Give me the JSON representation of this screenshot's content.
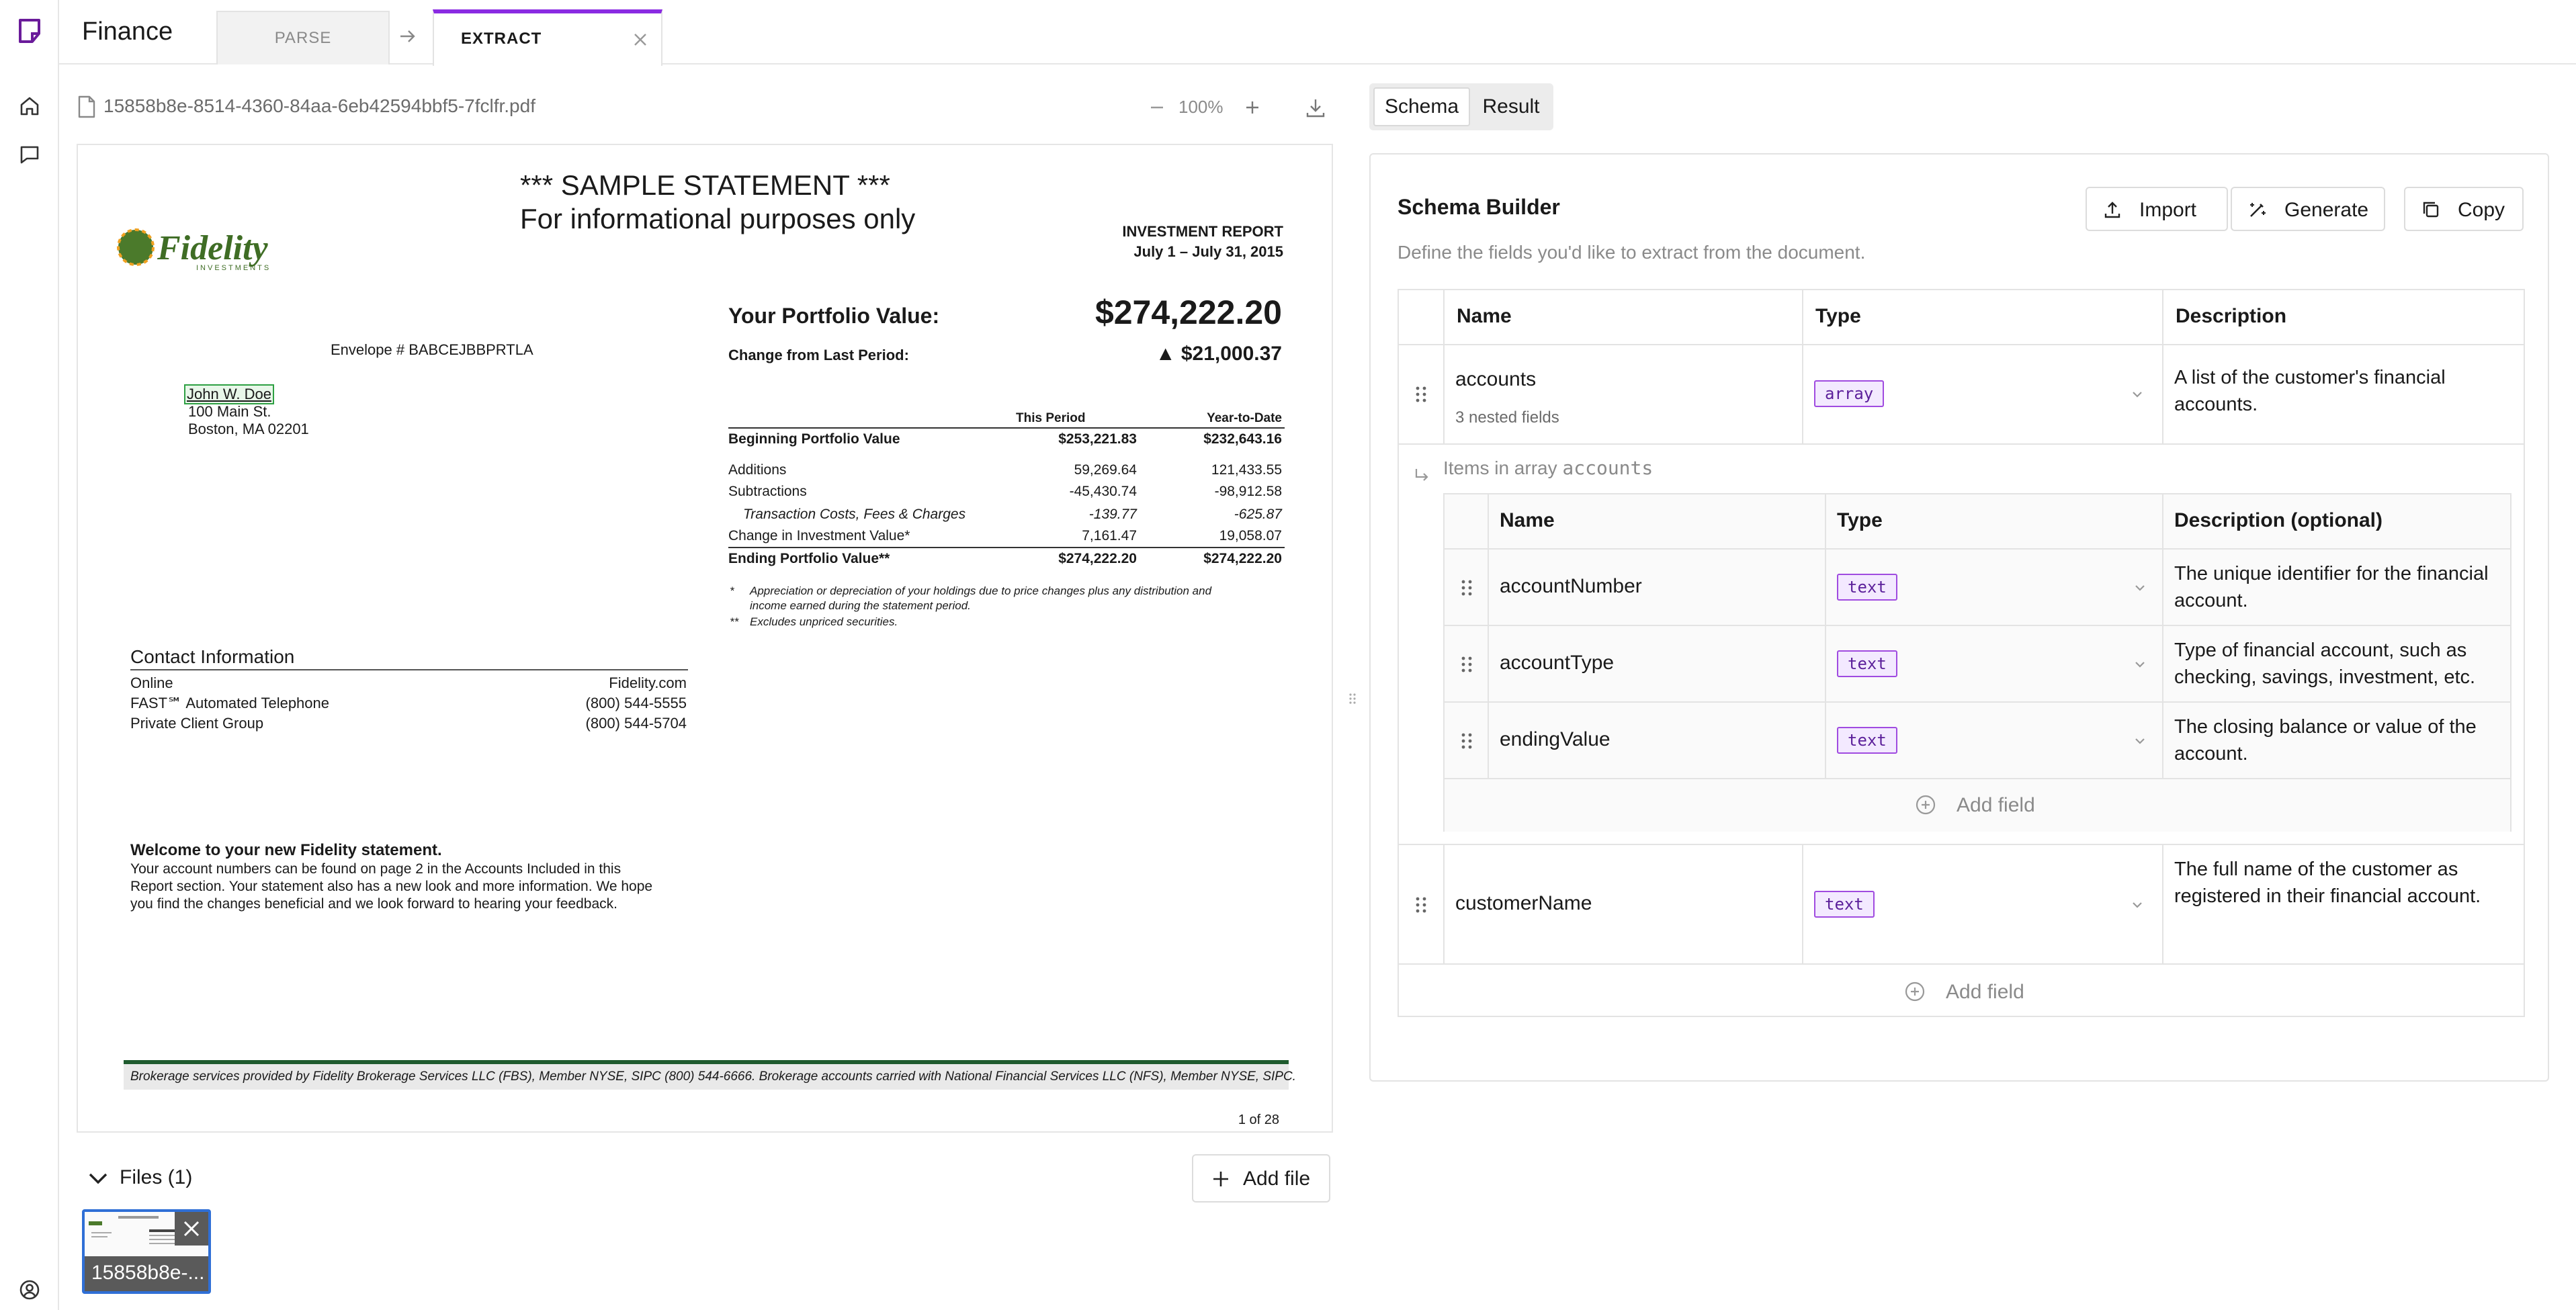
{
  "app": {
    "title": "Finance"
  },
  "tabs": {
    "parse_label": "PARSE",
    "extract_label": "EXTRACT"
  },
  "viewer": {
    "file_name": "15858b8e-8514-4360-84aa-6eb42594bbf5-7fclfr.pdf",
    "zoom_label": "100%"
  },
  "pdf": {
    "sample_line1": "*** SAMPLE STATEMENT ***",
    "sample_line2": "For informational purposes only",
    "logo_text": "Fidelity",
    "logo_sub": "INVESTMENTS",
    "report_title": "INVESTMENT REPORT",
    "report_period": "July 1 – July 31, 2015",
    "envelope": "Envelope # BABCEJBBPRTLA",
    "address": {
      "name": "John W. Doe",
      "street": "100 Main St.",
      "city": "Boston, MA  02201"
    },
    "portfolio_label": "Your Portfolio Value:",
    "portfolio_value": "$274,222.20",
    "change_label": "Change from Last Period:",
    "change_value": "▲  $21,000.37",
    "table": {
      "col_this": "This Period",
      "col_ytd": "Year-to-Date",
      "rows": [
        {
          "label": "Beginning Portfolio Value",
          "this": "$253,221.83",
          "ytd": "$232,643.16"
        },
        {
          "label": "Additions",
          "this": "59,269.64",
          "ytd": "121,433.55"
        },
        {
          "label": "Subtractions",
          "this": "-45,430.74",
          "ytd": "-98,912.58"
        },
        {
          "label": "Transaction Costs, Fees & Charges",
          "this": "-139.77",
          "ytd": "-625.87"
        },
        {
          "label": "Change in Investment Value*",
          "this": "7,161.47",
          "ytd": "19,058.07"
        },
        {
          "label": "Ending Portfolio Value**",
          "this": "$274,222.20",
          "ytd": "$274,222.20"
        }
      ]
    },
    "note1_mark": "*",
    "note1a": "Appreciation or depreciation of your holdings due to price changes plus any distribution and",
    "note1b": "income earned during the statement period.",
    "note2_mark": "**",
    "note2": "Excludes unpriced securities.",
    "contact": {
      "title": "Contact Information",
      "rows": [
        {
          "label": "Online",
          "value": "Fidelity.com"
        },
        {
          "label": "FAST℠ Automated Telephone",
          "value": "(800) 544-5555"
        },
        {
          "label": "Private Client Group",
          "value": "(800) 544-5704"
        }
      ]
    },
    "welcome_title": "Welcome to your new Fidelity statement.",
    "welcome_lines": [
      "Your account numbers can be found on page 2 in the Accounts Included in this",
      "Report section. Your statement also has a new look and more information. We hope",
      "you find the changes beneficial and we look forward to hearing your feedback."
    ],
    "footer": "Brokerage services provided by Fidelity Brokerage Services LLC (FBS), Member NYSE, SIPC (800) 544-6666. Brokerage accounts carried with National Financial Services LLC (NFS), Member NYSE, SIPC.",
    "page": "1 of 28"
  },
  "files": {
    "label": "Files (1)",
    "add_label": "Add file",
    "thumb_label": "15858b8e-..."
  },
  "panel": {
    "tab_schema": "Schema",
    "tab_result": "Result",
    "title": "Schema Builder",
    "subtitle": "Define the fields you'd like to extract from the document.",
    "import_label": "Import",
    "generate_label": "Generate",
    "copy_label": "Copy",
    "col_name": "Name",
    "col_type": "Type",
    "col_desc": "Description",
    "col_desc_optional": "Description (optional)",
    "accounts": {
      "name": "accounts",
      "nested": "3 nested fields",
      "type": "array",
      "desc": "A list of the customer's financial accounts."
    },
    "items_prefix": "Items in array ",
    "items_name": "accounts",
    "nested_fields": [
      {
        "name": "accountNumber",
        "type": "text",
        "desc": "The unique identifier for the financial account."
      },
      {
        "name": "accountType",
        "type": "text",
        "desc": "Type of financial account, such as checking, savings, investment, etc."
      },
      {
        "name": "endingValue",
        "type": "text",
        "desc": "The closing balance or value of the account."
      }
    ],
    "customer": {
      "name": "customerName",
      "type": "text",
      "desc": "The full name of the customer as registered in their financial account."
    },
    "add_field": "Add field"
  }
}
